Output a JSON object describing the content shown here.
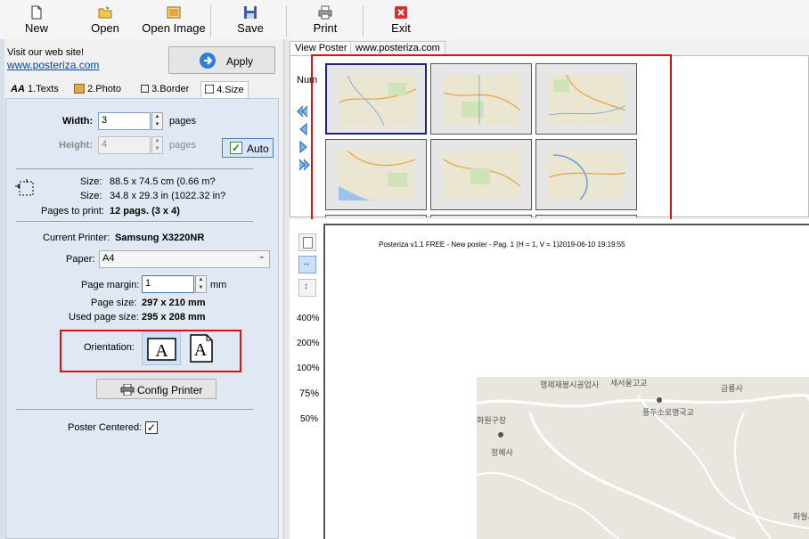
{
  "toolbar": {
    "new": "New",
    "open": "Open",
    "open_image": "Open Image",
    "save": "Save",
    "print": "Print",
    "exit": "Exit"
  },
  "left": {
    "visit_text": "Visit our web site!",
    "website": "www.posteriza.com",
    "apply": "Apply",
    "tabs": [
      "1.Texts",
      "2.Photo",
      "3.Border",
      "4.Size"
    ],
    "width_label": "Width:",
    "width_value": "3",
    "width_unit": "pages",
    "height_label": "Height:",
    "height_value": "4",
    "height_unit": "pages",
    "auto": "Auto",
    "size_label": "Size:",
    "size_cm": "88.5 x 74.5 cm (0.66 m?",
    "size_in": "34.8 x 29.3 in (1022.32 in?",
    "pages_to_print_label": "Pages to print:",
    "pages_to_print_value": "12 pags. (3 x 4)",
    "current_printer_label": "Current Printer:",
    "current_printer_value": "Samsung X3220NR",
    "paper_label": "Paper:",
    "paper_value": "A4",
    "page_margin_label": "Page margin:",
    "page_margin_value": "1",
    "page_margin_unit": "mm",
    "page_size_label": "Page size:",
    "page_size_value": "297 x 210 mm",
    "used_page_size_label": "Used page size:",
    "used_page_size_value": "295 x 208 mm",
    "orientation_label": "Orientation:",
    "config_printer": "Config Printer",
    "poster_centered_label": "Poster Centered:",
    "poster_centered_checked": true
  },
  "view": {
    "tabs": [
      "View Poster",
      "www.posteriza.com"
    ],
    "num_label": "Num",
    "header_text": "Posteriza v1.1 FREE - New poster - Pag. 1 (H = 1, V = 1)2019-06-10  19:19:55",
    "zoom_levels": [
      "400%",
      "200%",
      "100%",
      "75%",
      "50%"
    ],
    "map_labels": [
      "행제재봉시공업사",
      "세서울고교",
      "금룡사",
      "풍두소로명국교",
      "화원구장",
      "정혜사",
      "화월사"
    ]
  },
  "colors": {
    "highlight": "#e01010",
    "panel": "#dfe8f3",
    "selected_thumb": "#1a237e"
  }
}
